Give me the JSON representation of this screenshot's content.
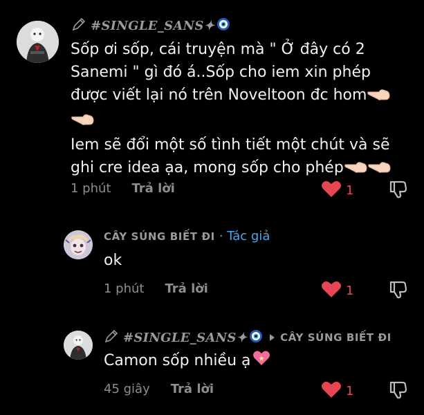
{
  "comments": [
    {
      "author": "#SINGLE_SANS✦",
      "text_lines": [
        "Sốp ơi sốp, cái truyện mà \" Ở đây có 2",
        "Sanemi \" gì đó á..Sốp cho iem xin phép",
        "được viết lại nó trên Noveltoon đc hom",
        "",
        "Iem sẽ đổi một số tình tiết một chút và sẽ",
        "ghi cre idea ạa, mong sốp cho phép"
      ],
      "time": "1 phút",
      "reply_label": "Trả lời",
      "likes": "1"
    },
    {
      "author": "CÂY SÚNG BIẾT ĐI",
      "author_tag": "· Tác giả",
      "text": "ok",
      "time": "1 phút",
      "reply_label": "Trả lời",
      "likes": "1"
    },
    {
      "author": "#SINGLE_SANS✦",
      "reply_to": "CÂY SÚNG BIẾT ĐI",
      "text": "Camon sốp nhiều ạ",
      "time": "45 giây",
      "reply_label": "Trả lời",
      "likes": "1"
    }
  ],
  "icons": {
    "pencil": "pencil-icon",
    "evil_eye": "evil-eye-icon",
    "heart": "heart-icon",
    "dislike": "dislike-icon",
    "pointing_hand": "pointing-hand-emoji",
    "sparkling_heart": "sparkling-heart-emoji",
    "reply_arrow": "reply-arrow-icon"
  },
  "colors": {
    "background": "#000000",
    "text": "#f1f1f1",
    "muted": "#8e8e8e",
    "heart": "#e64553",
    "author_tag": "#4aa8e8"
  }
}
